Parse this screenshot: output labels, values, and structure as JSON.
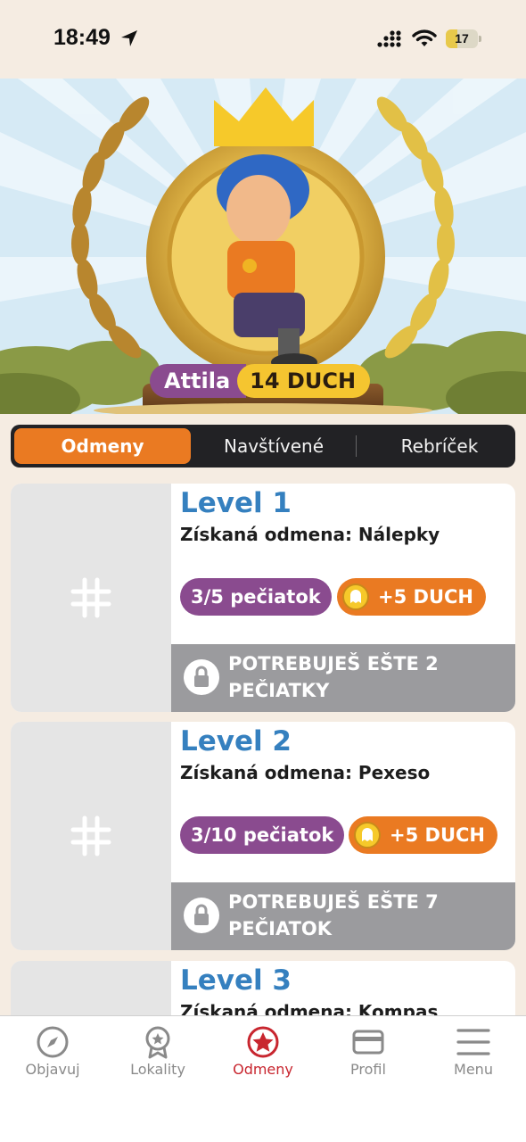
{
  "status_bar": {
    "time": "18:49",
    "battery": "17",
    "battery_level_percent": 17
  },
  "hero": {
    "name": "Attila",
    "points": "14 DUCH"
  },
  "tabs": [
    {
      "label": "Odmeny",
      "active": true
    },
    {
      "label": "Navštívené",
      "active": false
    },
    {
      "label": "Rebríček",
      "active": false
    }
  ],
  "levels": [
    {
      "title": "Level 1",
      "reward": "Získaná odmena: Nálepky",
      "stamps": "3/5 pečiatok",
      "bonus": "+5 DUCH",
      "lock_text": "POTREBUJEŠ EŠTE 2 PEČIATKY",
      "thumb_icon": "hash-icon"
    },
    {
      "title": "Level 2",
      "reward": "Získaná odmena: Pexeso",
      "stamps": "3/10 pečiatok",
      "bonus": "+5 DUCH",
      "lock_text": "POTREBUJEŠ EŠTE 7 PEČIATOK",
      "thumb_icon": "hash-icon"
    },
    {
      "title": "Level 3",
      "reward": "Získaná odmena: Kompas"
    }
  ],
  "bottom_nav": [
    {
      "label": "Objavuj",
      "icon": "compass-icon",
      "active": false
    },
    {
      "label": "Lokality",
      "icon": "award-icon",
      "active": false
    },
    {
      "label": "Odmeny",
      "icon": "star-badge-icon",
      "active": true
    },
    {
      "label": "Profil",
      "icon": "card-icon",
      "active": false
    },
    {
      "label": "Menu",
      "icon": "hamburger-icon",
      "active": false
    }
  ],
  "colors": {
    "background": "#f5ece2",
    "accent_orange": "#ea7a22",
    "purple": "#8a4b8f",
    "level_blue": "#3580bf",
    "active_nav_red": "#c8262f",
    "lock_gray": "#9b9b9e"
  }
}
